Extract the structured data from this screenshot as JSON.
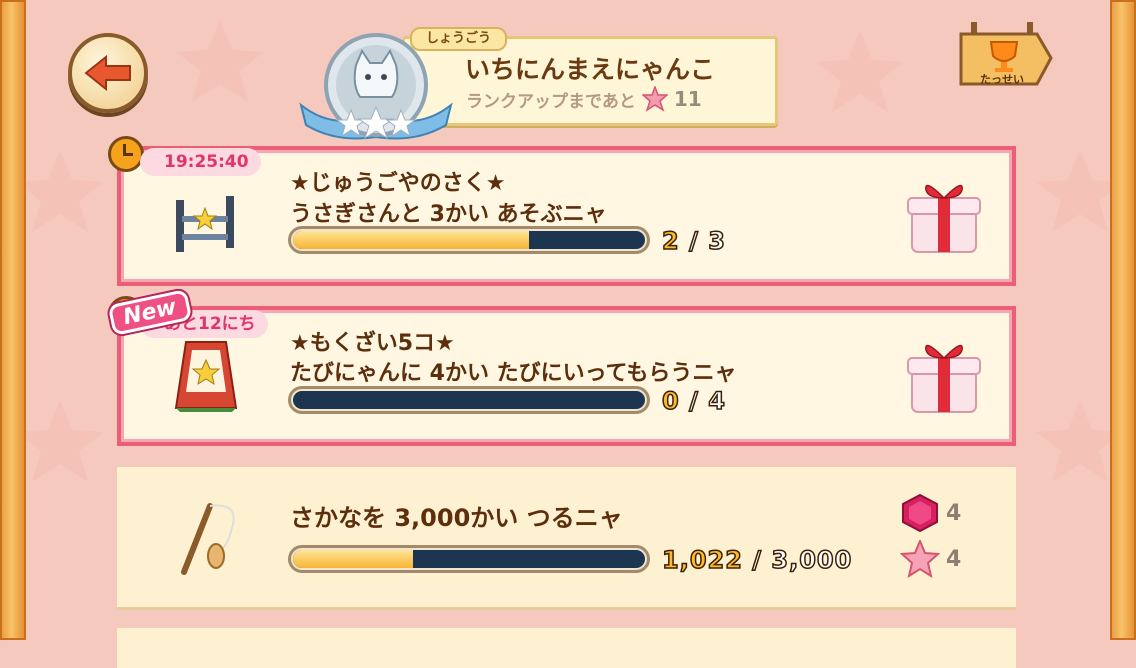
{
  "header": {
    "back_label": "back",
    "title_tag": "しょうごう",
    "title_name": "いちにんまえにゃんこ",
    "rank_up_text": "ランクアップまであと",
    "rank_up_count": "11",
    "achievements_label": "たっせい"
  },
  "missions": [
    {
      "timer": "19:25:40",
      "title": "★じゅうごやのさく★",
      "description": "うさぎさんと 3かい あそぶニャ",
      "current": "2",
      "separator": "/",
      "total": "3",
      "progress_fraction": 0.67,
      "reward": "gift-box-icon"
    },
    {
      "new_label": "New",
      "timer": "あと12にち",
      "title": "★もくざい5コ★",
      "description": "たびにゃんに 4かい たびにいってもらうニャ",
      "current": "0",
      "separator": "/",
      "total": "4",
      "progress_fraction": 0.0,
      "reward": "gift-box-icon"
    },
    {
      "title": "さかなを 3,000かい つるニャ",
      "current": "1,022",
      "separator": "/",
      "total": "3,000",
      "progress_fraction": 0.34,
      "rewards": [
        {
          "icon": "ruby-gem-icon",
          "amount": "4"
        },
        {
          "icon": "pink-star-icon",
          "amount": "4"
        }
      ]
    }
  ],
  "colors": {
    "background": "#f6c9bf",
    "frame": "#f0a84a",
    "active_border": "#ec5d76",
    "text_brown": "#5c2e0c",
    "progress_fill": "#f7b531",
    "progress_track": "#1c3550"
  }
}
